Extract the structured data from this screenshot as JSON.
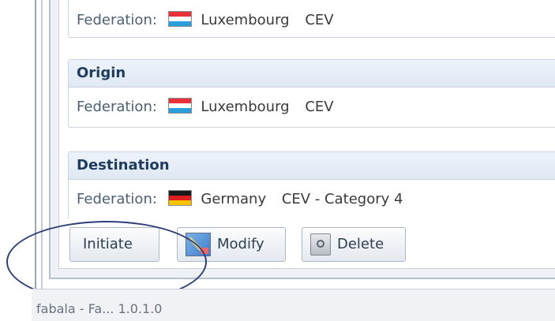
{
  "sections": {
    "top": {
      "row": {
        "label": "Federation:",
        "country": "Luxembourg",
        "confederation": "CEV"
      }
    },
    "origin": {
      "title": "Origin",
      "row": {
        "label": "Federation:",
        "country": "Luxembourg",
        "confederation": "CEV"
      }
    },
    "destination": {
      "title": "Destination",
      "row": {
        "label": "Federation:",
        "country": "Germany",
        "confederation": "CEV - Category 4"
      }
    }
  },
  "buttons": {
    "initiate": "Initiate",
    "modify": "Modify",
    "delete": "Delete"
  },
  "status_bar": {
    "text": "fabala - Fa... 1.0.1.0"
  },
  "colors": {
    "header_text": "#1f3c5e",
    "annotation_circle": "#2c3e7a"
  },
  "icons": [
    "luxembourg-flag-icon",
    "germany-flag-icon",
    "modify-icon",
    "delete-icon"
  ]
}
